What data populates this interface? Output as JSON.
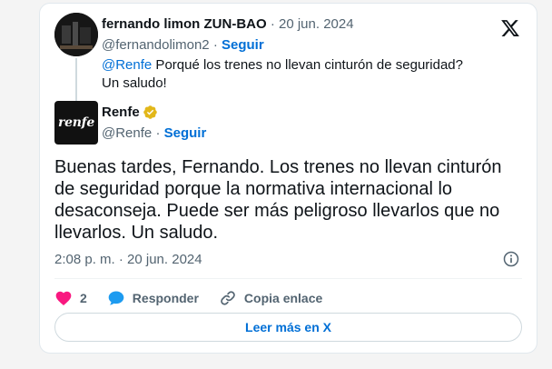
{
  "quoted": {
    "name": "fernando limon ZUN-BAO",
    "date": "· 20 jun. 2024",
    "handle": "@fernandolimon2",
    "separator": "·",
    "follow_label": "Seguir",
    "mention": "@Renfe",
    "text_line1": " Porqué los trenes no llevan cinturón de seguridad?",
    "text_line2": "Un saludo!"
  },
  "tweet": {
    "name": "Renfe",
    "avatar_text": "renfe",
    "handle": "@Renfe",
    "separator": "·",
    "follow_label": "Seguir",
    "body": "Buenas tardes, Fernando. Los trenes no llevan cinturón de seguridad porque la normativa internacional lo desaconseja. Puede ser más peligroso llevarlos que no llevarlos. Un saludo.",
    "timestamp": "2:08 p. m. · 20 jun. 2024"
  },
  "actions": {
    "likes": "2",
    "reply_label": "Responder",
    "copy_label": "Copia enlace"
  },
  "read_more_label": "Leer más en X",
  "icons": {
    "logo": "x-logo-icon",
    "verified": "verified-badge-icon",
    "info": "info-icon",
    "like": "heart-icon",
    "reply": "speech-bubble-icon",
    "copy": "link-icon"
  },
  "colors": {
    "link_blue": "#006fd6",
    "muted": "#536471",
    "like_pink": "#f91880",
    "reply_blue": "#1d9bf0",
    "badge_gold": "#e2b719"
  }
}
